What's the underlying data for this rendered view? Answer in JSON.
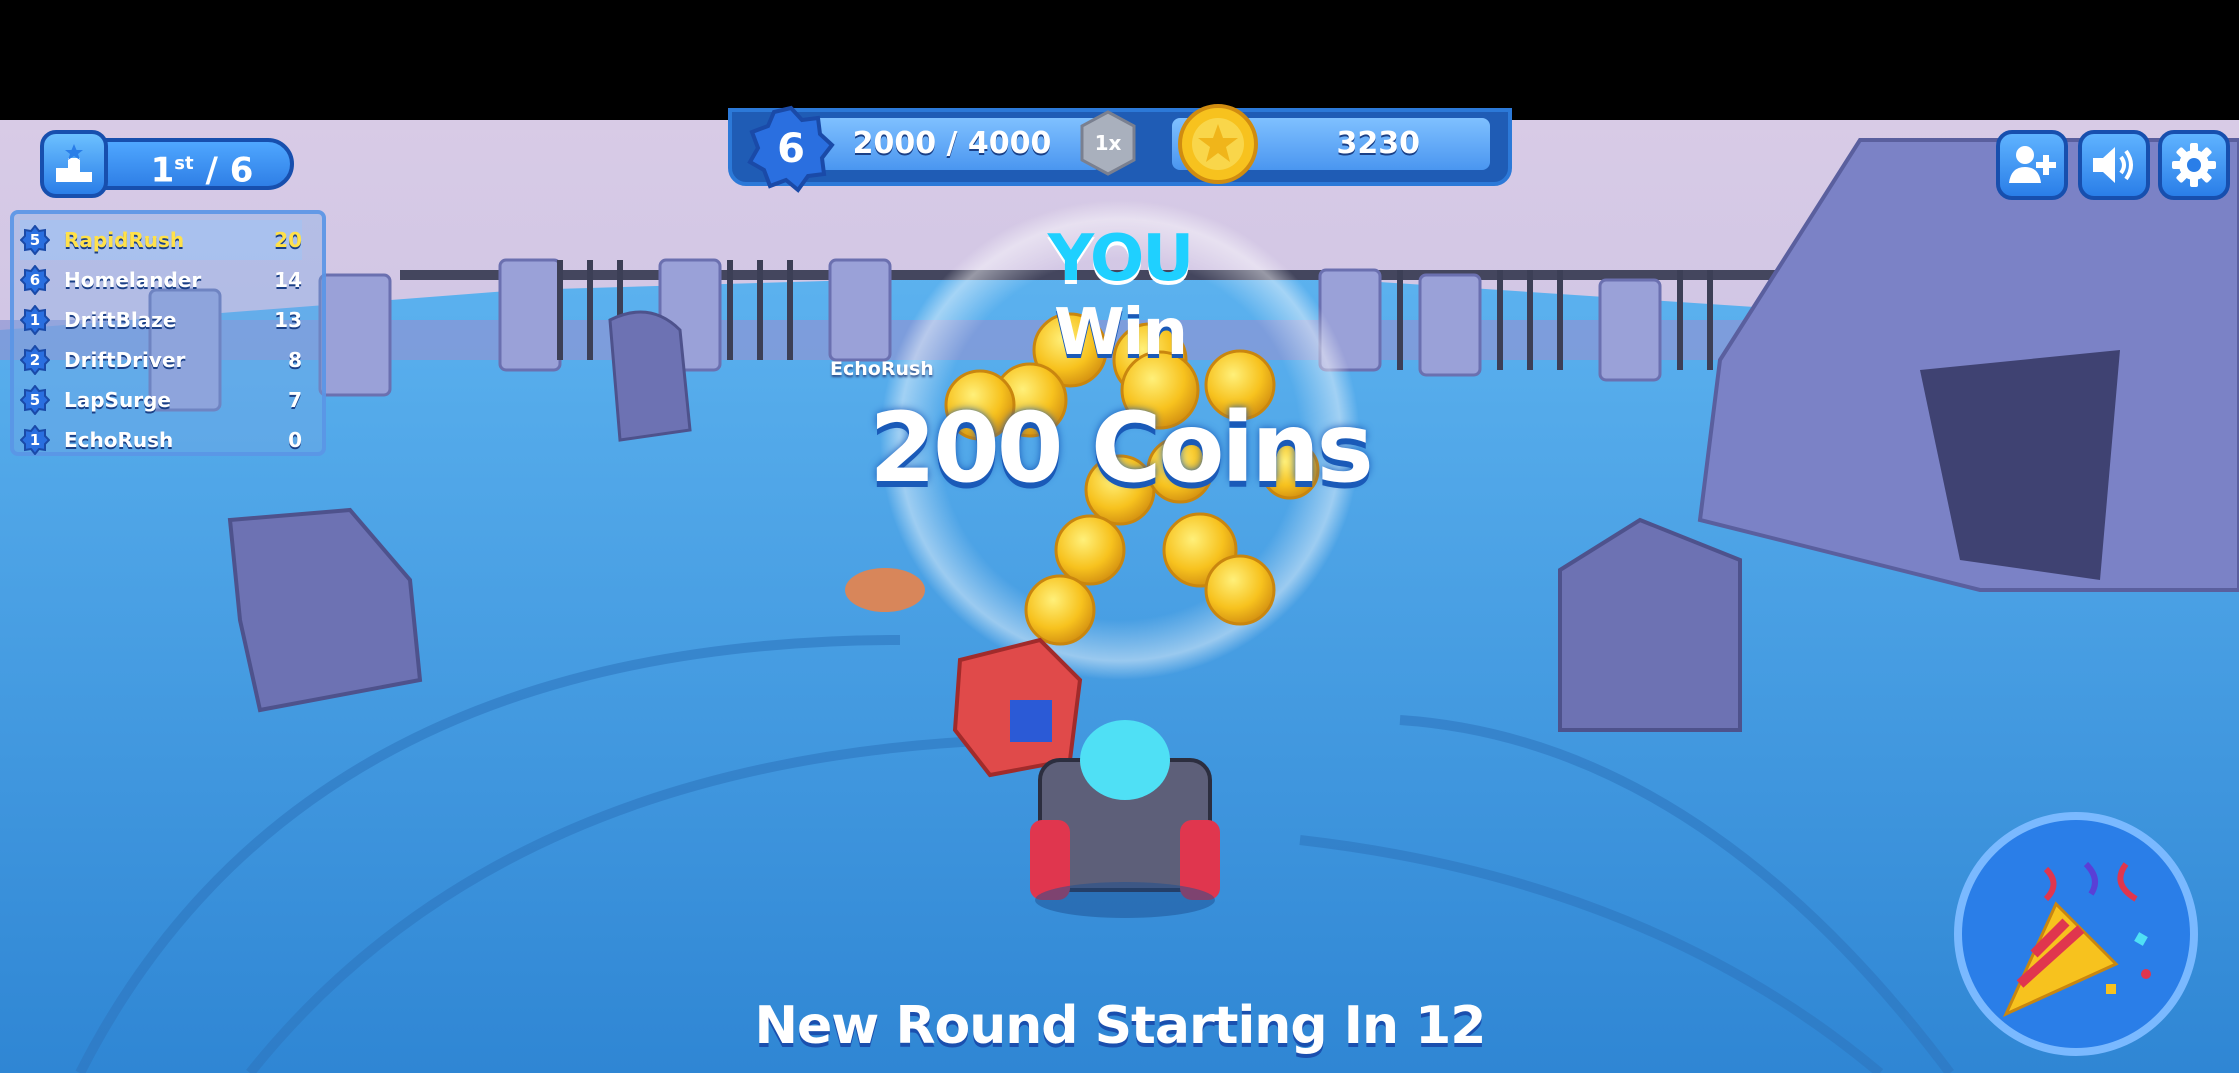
{
  "hud": {
    "rank": {
      "position": "1",
      "suffix": "st",
      "total": "/ 6"
    },
    "leaderboard": [
      {
        "level": "5",
        "name": "RapidRush",
        "score": "20"
      },
      {
        "level": "6",
        "name": "Homelander",
        "score": "14"
      },
      {
        "level": "1",
        "name": "DriftBlaze",
        "score": "13"
      },
      {
        "level": "2",
        "name": "DriftDriver",
        "score": "8"
      },
      {
        "level": "5",
        "name": "LapSurge",
        "score": "7"
      },
      {
        "level": "1",
        "name": "EchoRush",
        "score": "0"
      }
    ],
    "player_level": "6",
    "xp": "2000 / 4000",
    "multiplier": "1x",
    "coins": "3230"
  },
  "buttons": {
    "invite_icon": "add-friend-icon",
    "sound_icon": "speaker-icon",
    "settings_icon": "gear-icon",
    "celebrate_icon": "party-popper-icon"
  },
  "result": {
    "you": "YOU",
    "win": "Win",
    "reward": "200 Coins",
    "opponent_tag": "EchoRush",
    "next_round": "New Round Starting In 12"
  },
  "colors": {
    "accent": "#2a7ee8",
    "highlight": "#ffe14a",
    "win_cyan": "#1fd0ff",
    "ground": "#3e9ae0"
  }
}
